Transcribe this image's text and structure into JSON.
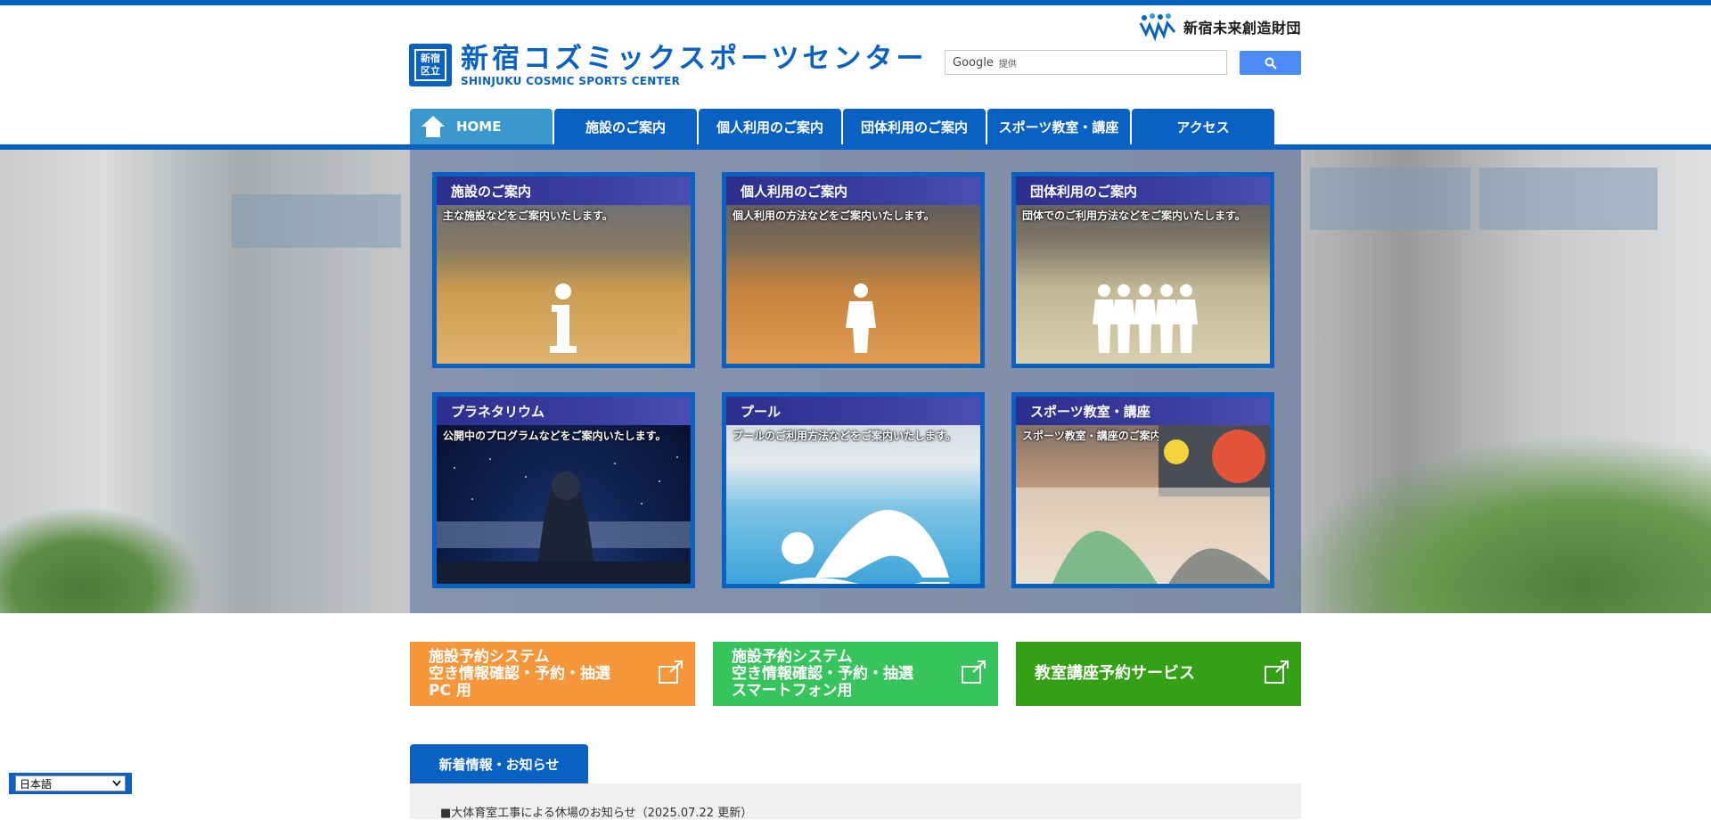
{
  "header": {
    "foundation_name": "新宿未来創造財団",
    "logo_badge_text": "新宿区立",
    "logo_title": "新宿コズミックスポーツセンター",
    "logo_subtitle": "SHINJUKU COSMIC SPORTS CENTER"
  },
  "search": {
    "brand": "Google",
    "sub": "提供",
    "button_icon": "search-icon"
  },
  "nav": {
    "items": [
      {
        "label": "HOME",
        "icon": "home-icon"
      },
      {
        "label": "施設のご案内"
      },
      {
        "label": "個人利用のご案内"
      },
      {
        "label": "団体利用のご案内"
      },
      {
        "label": "スポーツ教室・講座"
      },
      {
        "label": "アクセス"
      }
    ]
  },
  "tiles": [
    {
      "title": "施設のご案内",
      "desc": "主な施設などをご案内いたします。",
      "icon": "info-icon"
    },
    {
      "title": "個人利用のご案内",
      "desc": "個人利用の方法などをご案内いたします。",
      "icon": "person-icon"
    },
    {
      "title": "団体利用のご案内",
      "desc": "団体でのご利用方法などをご案内いたします。",
      "icon": "group-icon"
    },
    {
      "title": "プラネタリウム",
      "desc": "公開中のプログラムなどをご案内いたします。",
      "icon": "planetarium-projector"
    },
    {
      "title": "プール",
      "desc": "プールのご利用方法などをご案内いたします。",
      "icon": "swimmer-icon"
    },
    {
      "title": "スポーツ教室・講座",
      "desc": "スポーツ教室・講座のご案内です。",
      "icon": "sports-photo"
    }
  ],
  "banners": [
    {
      "line1": "施設予約システム",
      "line2": "空き情報確認・予約・抽選",
      "line3": "PC 用",
      "color": "#f7963a",
      "icon": "external-link-icon"
    },
    {
      "line1": "施設予約システム",
      "line2": "空き情報確認・予約・抽選",
      "line3": "スマートフォン用",
      "color": "#37c45c",
      "icon": "external-link-icon"
    },
    {
      "line1": "教室講座予約サービス",
      "color": "#34a016",
      "icon": "external-link-icon"
    }
  ],
  "news": {
    "tab_label": "新着情報・お知らせ",
    "items": [
      "■大体育室工事による休場のお知らせ（2025.07.22 更新）"
    ]
  },
  "language": {
    "selected": "日本語"
  },
  "colors": {
    "brand_blue": "#0a61c4",
    "home_tab": "#3a98cf",
    "tile_title_bar": "#2c2f8e"
  }
}
